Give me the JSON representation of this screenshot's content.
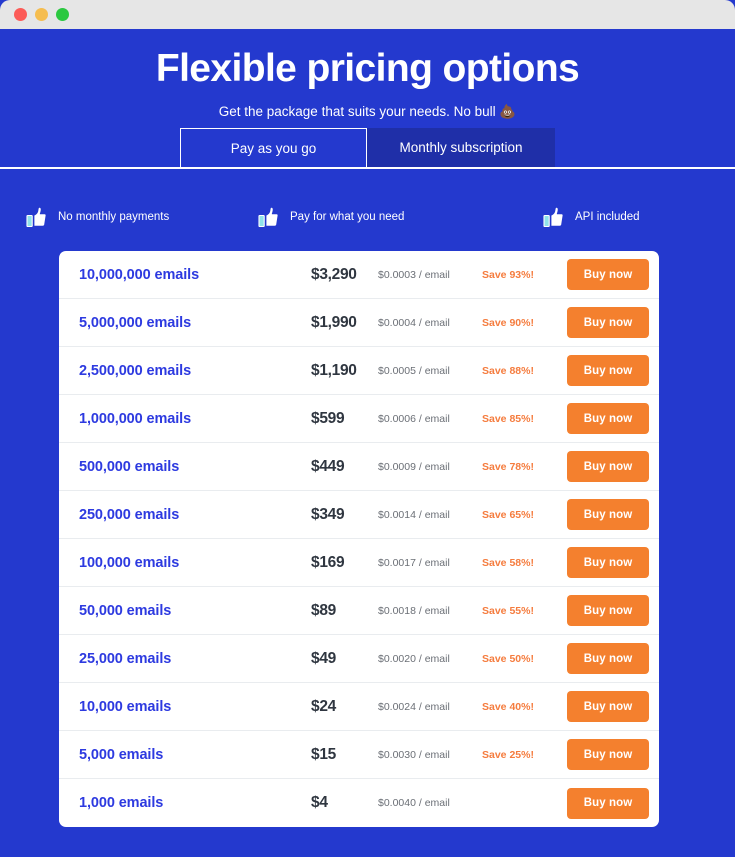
{
  "window": {
    "traffic_lights": [
      {
        "name": "close-button",
        "color": "#fc5b57"
      },
      {
        "name": "minimize-button",
        "color": "#f5bd4f"
      },
      {
        "name": "maximize-button",
        "color": "#2bc840"
      }
    ]
  },
  "hero": {
    "title": "Flexible pricing options",
    "subtitle": "Get the package that suits your needs. No bull 💩"
  },
  "tabs": [
    {
      "label": "Pay as you go",
      "active": true
    },
    {
      "label": "Monthly subscription",
      "active": false
    }
  ],
  "features": [
    {
      "icon": "thumbs-up-icon",
      "label": "No monthly payments"
    },
    {
      "icon": "thumbs-up-icon",
      "label": "Pay for what you need"
    },
    {
      "icon": "thumbs-up-icon",
      "label": "API included"
    }
  ],
  "colors": {
    "background_blue": "#2439ce",
    "tab_inactive_blue": "#1f2fa8",
    "volume_blue": "#2d3ae0",
    "accent_orange": "#f4802e",
    "save_orange": "#f57c3e",
    "card_white": "#ffffff",
    "titlebar_gray": "#e6e6e6"
  },
  "pricing": {
    "buy_label": "Buy now",
    "rows": [
      {
        "volume": "10,000,000 emails",
        "price": "$3,290",
        "rate": "$0.0003 / email",
        "save": "Save 93%!"
      },
      {
        "volume": "5,000,000 emails",
        "price": "$1,990",
        "rate": "$0.0004 / email",
        "save": "Save 90%!"
      },
      {
        "volume": "2,500,000 emails",
        "price": "$1,190",
        "rate": "$0.0005 / email",
        "save": "Save 88%!"
      },
      {
        "volume": "1,000,000 emails",
        "price": "$599",
        "rate": "$0.0006 / email",
        "save": "Save 85%!"
      },
      {
        "volume": "500,000 emails",
        "price": "$449",
        "rate": "$0.0009 / email",
        "save": "Save 78%!"
      },
      {
        "volume": "250,000 emails",
        "price": "$349",
        "rate": "$0.0014 / email",
        "save": "Save 65%!"
      },
      {
        "volume": "100,000 emails",
        "price": "$169",
        "rate": "$0.0017 / email",
        "save": "Save 58%!"
      },
      {
        "volume": "50,000 emails",
        "price": "$89",
        "rate": "$0.0018 / email",
        "save": "Save 55%!"
      },
      {
        "volume": "25,000 emails",
        "price": "$49",
        "rate": "$0.0020 / email",
        "save": "Save 50%!"
      },
      {
        "volume": "10,000 emails",
        "price": "$24",
        "rate": "$0.0024 / email",
        "save": "Save 40%!"
      },
      {
        "volume": "5,000 emails",
        "price": "$15",
        "rate": "$0.0030 / email",
        "save": "Save 25%!"
      },
      {
        "volume": "1,000 emails",
        "price": "$4",
        "rate": "$0.0040 / email",
        "save": ""
      }
    ]
  }
}
